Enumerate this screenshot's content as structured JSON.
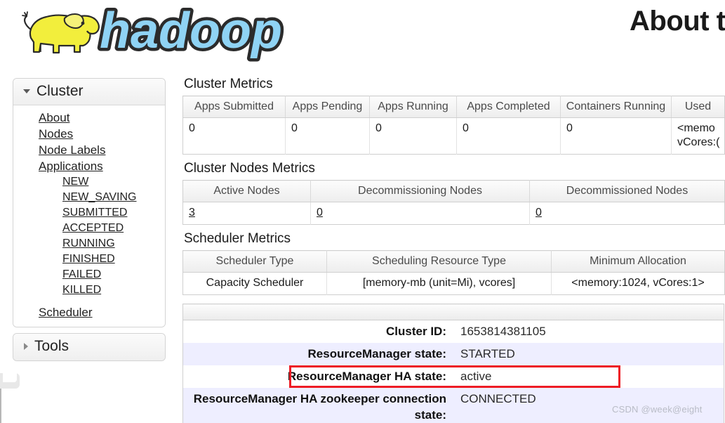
{
  "header": {
    "logo_alt": "hadoop-elephant-logo",
    "title": "About t"
  },
  "sidebar": {
    "cluster": {
      "label": "Cluster",
      "expanded": true,
      "items": [
        {
          "label": "About",
          "level": 1
        },
        {
          "label": "Nodes",
          "level": 1
        },
        {
          "label": "Node Labels",
          "level": 1
        },
        {
          "label": "Applications",
          "level": 1
        },
        {
          "label": "NEW",
          "level": 2
        },
        {
          "label": "NEW_SAVING",
          "level": 2
        },
        {
          "label": "SUBMITTED",
          "level": 2
        },
        {
          "label": "ACCEPTED",
          "level": 2
        },
        {
          "label": "RUNNING",
          "level": 2
        },
        {
          "label": "FINISHED",
          "level": 2
        },
        {
          "label": "FAILED",
          "level": 2
        },
        {
          "label": "KILLED",
          "level": 2
        },
        {
          "label": "Scheduler",
          "level": 1
        }
      ]
    },
    "tools": {
      "label": "Tools",
      "expanded": false
    }
  },
  "main": {
    "cluster_metrics": {
      "title": "Cluster Metrics",
      "headers": [
        "Apps Submitted",
        "Apps Pending",
        "Apps Running",
        "Apps Completed",
        "Containers Running",
        "Used"
      ],
      "row": [
        "0",
        "0",
        "0",
        "0",
        "0",
        "<memo\nvCores:("
      ]
    },
    "cluster_nodes_metrics": {
      "title": "Cluster Nodes Metrics",
      "headers": [
        "Active Nodes",
        "Decommissioning Nodes",
        "Decommissioned Nodes"
      ],
      "row": [
        "3",
        "0",
        "0"
      ]
    },
    "scheduler_metrics": {
      "title": "Scheduler Metrics",
      "headers": [
        "Scheduler Type",
        "Scheduling Resource Type",
        "Minimum Allocation"
      ],
      "row": [
        "Capacity Scheduler",
        "[memory-mb (unit=Mi), vcores]",
        "<memory:1024, vCores:1>"
      ]
    },
    "details": {
      "rows": [
        {
          "key": "Cluster ID:",
          "value": "1653814381105",
          "shaded": false
        },
        {
          "key": "ResourceManager state:",
          "value": "STARTED",
          "shaded": true
        },
        {
          "key": "ResourceManager HA state:",
          "value": "active",
          "shaded": false,
          "highlighted": true
        },
        {
          "key": "ResourceManager HA zookeeper connection state:",
          "value": "CONNECTED",
          "shaded": true
        }
      ]
    }
  },
  "annotation": {
    "highlight_color": "#ee1c25"
  },
  "watermark": {
    "text": "CSDN @week@eight"
  }
}
